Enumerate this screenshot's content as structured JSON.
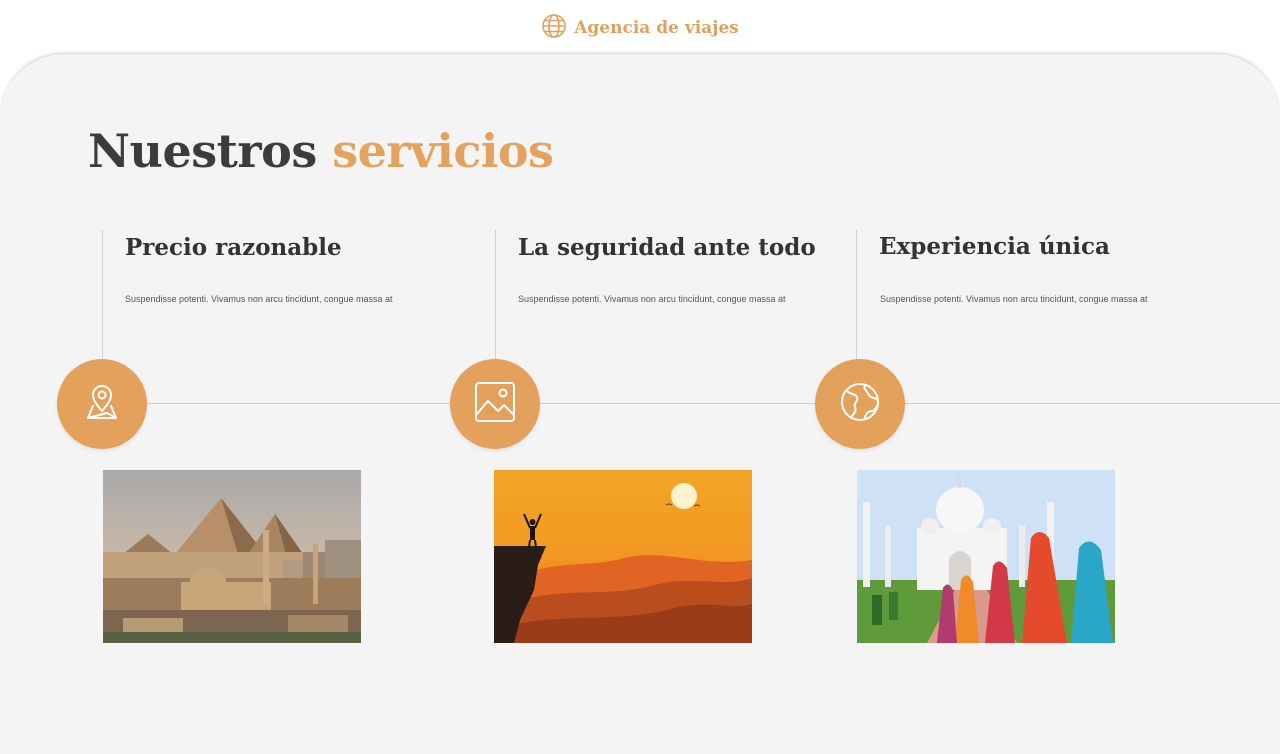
{
  "header": {
    "brand_name": "Agencia de viajes",
    "brand_icon": "globe-icon"
  },
  "main": {
    "title_part1": "Nuestros",
    "title_part2": "servicios",
    "services": [
      {
        "title": "Precio razonable",
        "text": "Suspendisse potenti. Vivamus non arcu tincidunt, congue massa at",
        "icon": "map-pin-icon",
        "image": "pyramids-photo"
      },
      {
        "title": "La seguridad ante todo",
        "text": "Suspendisse potenti. Vivamus non arcu tincidunt, congue massa at",
        "icon": "image-icon",
        "image": "sunset-hiker-photo"
      },
      {
        "title": "Experiencia única",
        "text": "Suspendisse potenti. Vivamus non arcu tincidunt, congue massa at",
        "icon": "globe-icon",
        "image": "taj-mahal-photo"
      }
    ]
  },
  "colors": {
    "accent": "#e3a15c",
    "text": "#333333",
    "panel_bg": "#f4f4f5"
  }
}
